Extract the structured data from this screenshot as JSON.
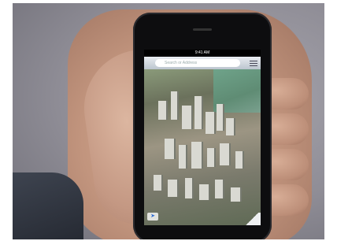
{
  "photo": {
    "subject": "Hand holding smartphone showing 3D city map",
    "status_time": "9:41 AM",
    "search_placeholder": "Search or Address",
    "locate_icon": "location-arrow-icon",
    "menu_icon": "list-icon"
  },
  "colors": {
    "background": "#8f8d96",
    "skin": "#c2957e",
    "phone_body": "#0d0d0f",
    "map_buildings": "#d9d9d2",
    "water": "#6fa38a"
  }
}
